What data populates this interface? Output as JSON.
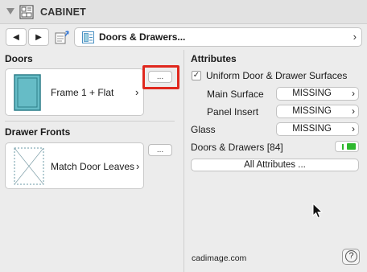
{
  "panel": {
    "title": "CABINET",
    "breadcrumb": "Doors & Drawers..."
  },
  "nav": {
    "back_glyph": "◀",
    "forward_glyph": "▶",
    "chevron": "›"
  },
  "doors": {
    "section_label": "Doors",
    "item_label": "Frame 1 + Flat",
    "chevron": "›",
    "more_label": "..."
  },
  "drawer_fronts": {
    "section_label": "Drawer Fronts",
    "item_label": "Match Door Leaves",
    "chevron": "›",
    "more_label": "..."
  },
  "attributes": {
    "section_label": "Attributes",
    "uniform_checkbox": {
      "label": "Uniform Door & Drawer Surfaces",
      "checked": true,
      "glyph": "✓"
    },
    "rows": [
      {
        "label": "Main Surface",
        "value": "MISSING"
      },
      {
        "label": "Panel Insert",
        "value": "MISSING"
      },
      {
        "label": "Glass",
        "value": "MISSING"
      }
    ],
    "pill_chevron": "›",
    "doors_drawers_label": "Doors & Drawers [84]",
    "all_attributes_label": "All Attributes ..."
  },
  "footer": {
    "brand": "cadimage.com",
    "help_glyph": "?"
  },
  "colors": {
    "background": "#ececec",
    "door_fill": "#66bcc6",
    "toggle_green": "#2eb82e",
    "highlight_red": "#e0281e"
  },
  "icons": {
    "collapse": "triangle-down-icon",
    "title": "cabinet-icon",
    "nav_page": "page-arrow-icon",
    "breadcrumb": "doors-drawers-icon",
    "help": "help-icon",
    "cursor": "mouse-cursor-icon"
  }
}
